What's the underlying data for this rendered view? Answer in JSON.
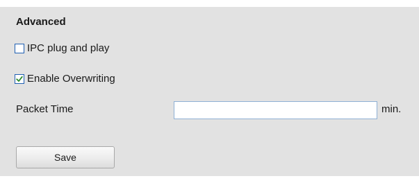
{
  "section": {
    "title": "Advanced"
  },
  "options": {
    "ipc_plug_and_play": {
      "label": "IPC plug and play",
      "checked": false
    },
    "enable_overwriting": {
      "label": "Enable Overwriting",
      "checked": true
    }
  },
  "packet_time": {
    "label": "Packet Time",
    "value": "",
    "unit": "min."
  },
  "actions": {
    "save_label": "Save"
  },
  "colors": {
    "panel_background": "#e2e2e2",
    "checkbox_border": "#1f5fb2",
    "checkmark": "#2a8a2a",
    "input_border": "#8fb0d4"
  }
}
